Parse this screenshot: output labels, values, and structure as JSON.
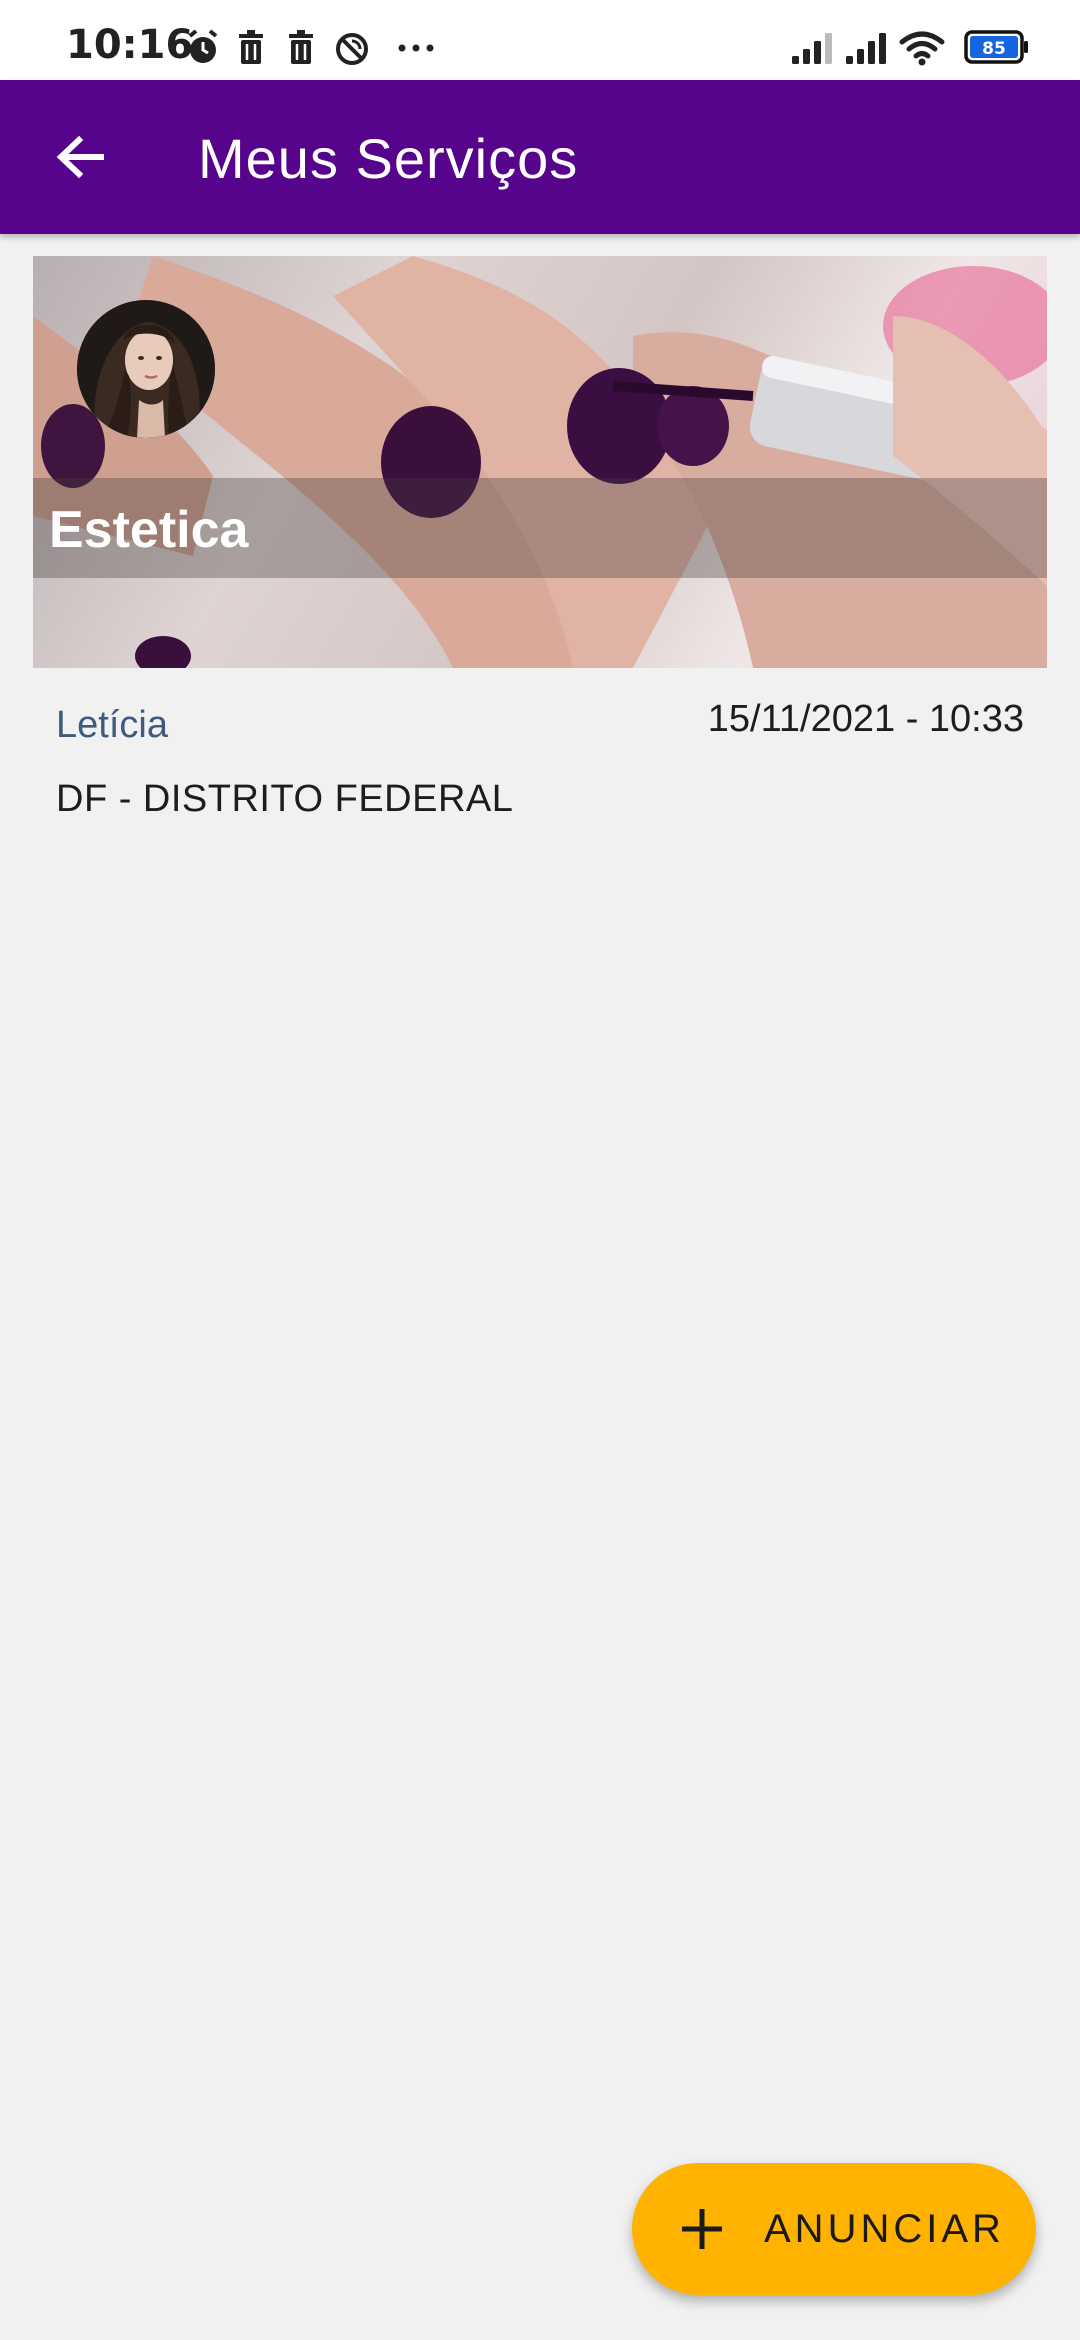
{
  "status_bar": {
    "time": "10:16",
    "left_icons": [
      "alarm-icon",
      "trash-icon",
      "trash-icon",
      "no-disturb-icon",
      "more-dots-icon"
    ],
    "right_icons": [
      "signal-icon",
      "signal-icon",
      "wifi-icon",
      "battery-icon"
    ],
    "battery_level": "85"
  },
  "app_bar": {
    "title": "Meus Serviços",
    "back_icon": "arrow-left-icon",
    "color": "#56048c"
  },
  "services": [
    {
      "category": "Estetica",
      "provider": "Letícia",
      "date": "15/11/2021 - 10:33",
      "location": "DF - DISTRITO FEDERAL"
    }
  ],
  "fab": {
    "label": "ANUNCIAR",
    "icon": "plus-icon",
    "color": "#ffb300"
  }
}
